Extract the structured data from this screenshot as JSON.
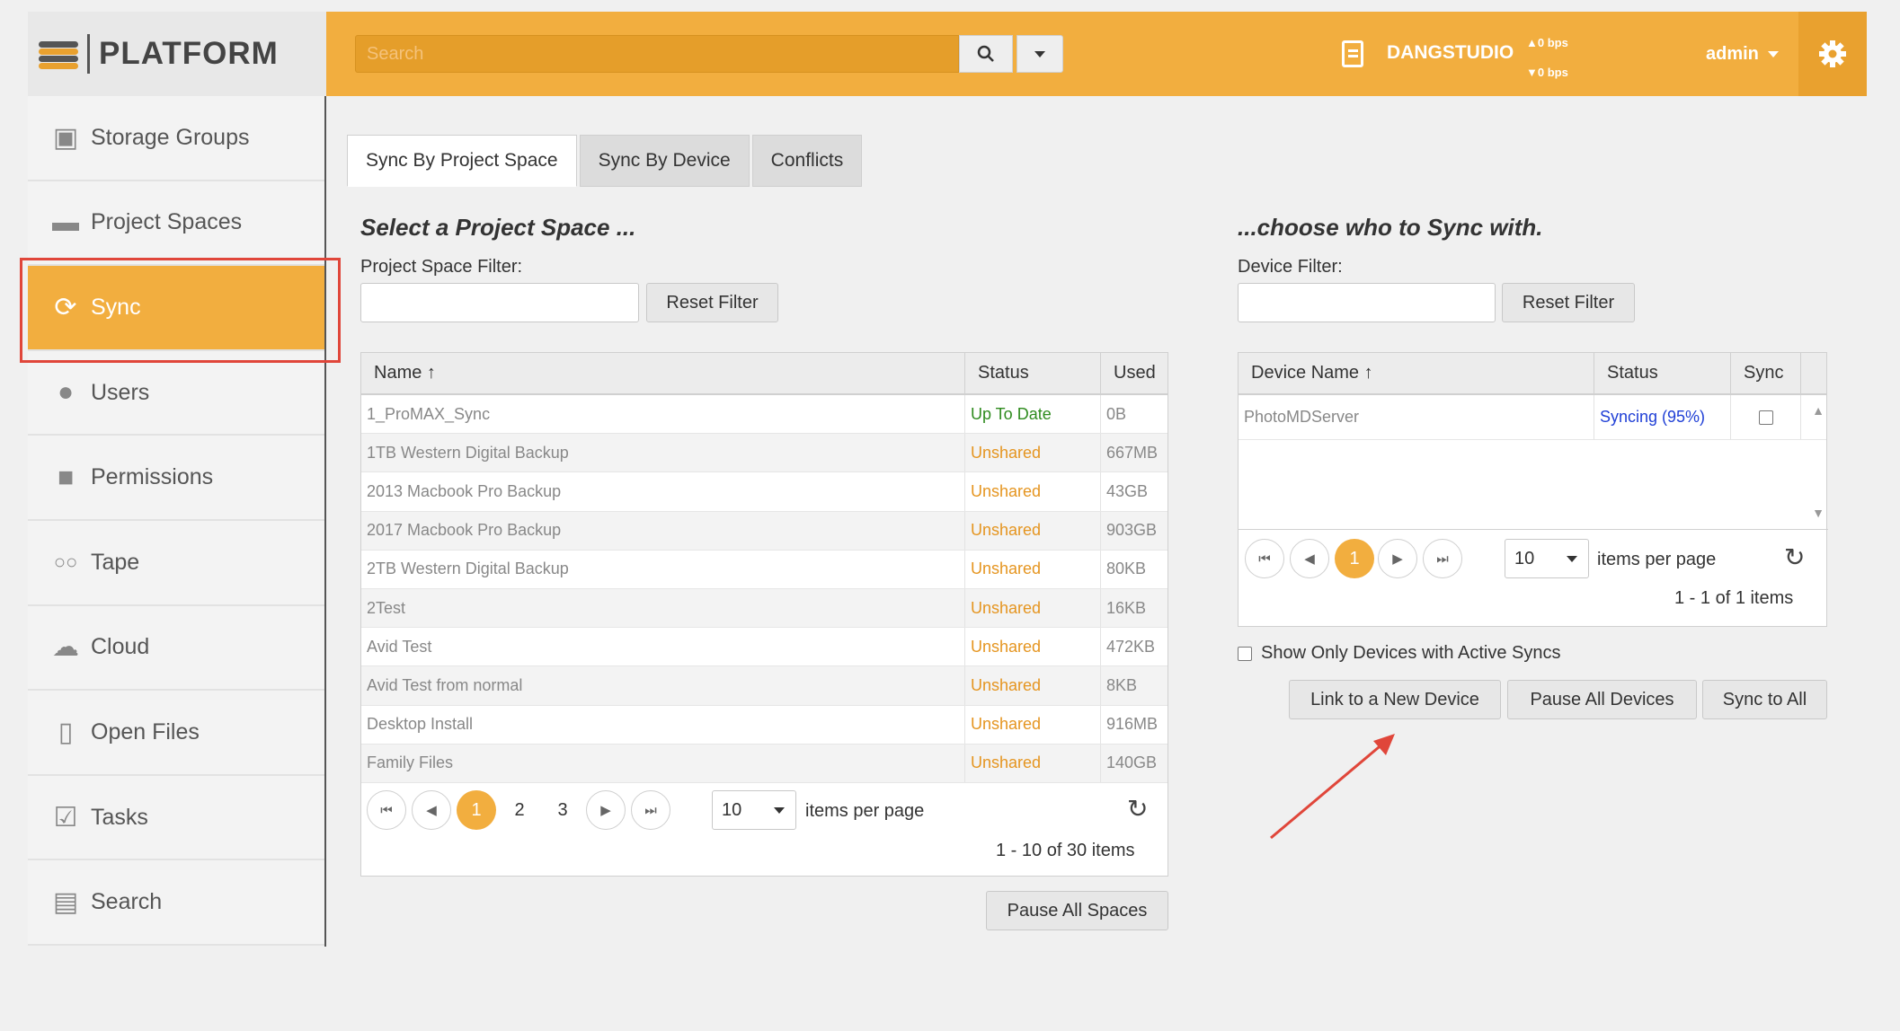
{
  "brand": {
    "name": "PLATFORM"
  },
  "header": {
    "search_placeholder": "Search",
    "studio": "DANGSTUDIO",
    "upload_rate": "▲0 bps",
    "download_rate": "▼0 bps",
    "user": "admin",
    "icons": [
      "search-icon",
      "chevron-down-icon",
      "server-icon",
      "gear-icon"
    ]
  },
  "sidebar": {
    "items": [
      {
        "label": "Storage Groups",
        "icon": "storage-icon"
      },
      {
        "label": "Project Spaces",
        "icon": "folder-icon"
      },
      {
        "label": "Sync",
        "icon": "sync-icon",
        "active": true
      },
      {
        "label": "Users",
        "icon": "users-icon"
      },
      {
        "label": "Permissions",
        "icon": "lock-icon"
      },
      {
        "label": "Tape",
        "icon": "tape-icon"
      },
      {
        "label": "Cloud",
        "icon": "cloud-icon"
      },
      {
        "label": "Open Files",
        "icon": "file-icon"
      },
      {
        "label": "Tasks",
        "icon": "tasks-icon"
      },
      {
        "label": "Search",
        "icon": "search-doc-icon"
      }
    ]
  },
  "tabs": [
    {
      "label": "Sync By Project Space",
      "active": true
    },
    {
      "label": "Sync By Device"
    },
    {
      "label": "Conflicts"
    }
  ],
  "left_panel": {
    "title": "Select a Project Space ...",
    "filter_label": "Project Space Filter:",
    "reset_label": "Reset Filter",
    "columns": [
      "Name ↑",
      "Status",
      "Used"
    ],
    "rows": [
      {
        "name": "1_ProMAX_Sync",
        "status": "Up To Date",
        "used": "0B"
      },
      {
        "name": "1TB Western Digital Backup",
        "status": "Unshared",
        "used": "667MB"
      },
      {
        "name": "2013 Macbook Pro Backup",
        "status": "Unshared",
        "used": "43GB"
      },
      {
        "name": "2017 Macbook Pro Backup",
        "status": "Unshared",
        "used": "903GB"
      },
      {
        "name": "2TB Western Digital Backup",
        "status": "Unshared",
        "used": "80KB"
      },
      {
        "name": "2Test",
        "status": "Unshared",
        "used": "16KB"
      },
      {
        "name": "Avid Test",
        "status": "Unshared",
        "used": "472KB"
      },
      {
        "name": "Avid Test from normal",
        "status": "Unshared",
        "used": "8KB"
      },
      {
        "name": "Desktop Install",
        "status": "Unshared",
        "used": "916MB"
      },
      {
        "name": "Family Files",
        "status": "Unshared",
        "used": "140GB"
      }
    ],
    "pages": [
      "1",
      "2",
      "3"
    ],
    "page_size": "10",
    "items_per_page": "items per page",
    "summary": "1 - 10 of 30 items",
    "pause_label": "Pause All Spaces"
  },
  "right_panel": {
    "title": "...choose who to Sync with.",
    "filter_label": "Device Filter:",
    "reset_label": "Reset Filter",
    "columns": [
      "Device Name ↑",
      "Status",
      "Sync"
    ],
    "rows": [
      {
        "name": "PhotoMDServer",
        "status": "Syncing (95%)"
      }
    ],
    "pages": [
      "1"
    ],
    "page_size": "10",
    "items_per_page": "items per page",
    "summary": "1 - 1 of 1 items",
    "show_active_label": "Show Only Devices with Active Syncs",
    "link_label": "Link to a New Device",
    "pause_label": "Pause All Devices",
    "sync_all_label": "Sync to All"
  },
  "colors": {
    "accent": "#f2ae3f",
    "highlight": "#e0463a",
    "up_to_date": "#2e8b1e",
    "unshared": "#e59520",
    "syncing": "#1f3fd6"
  }
}
